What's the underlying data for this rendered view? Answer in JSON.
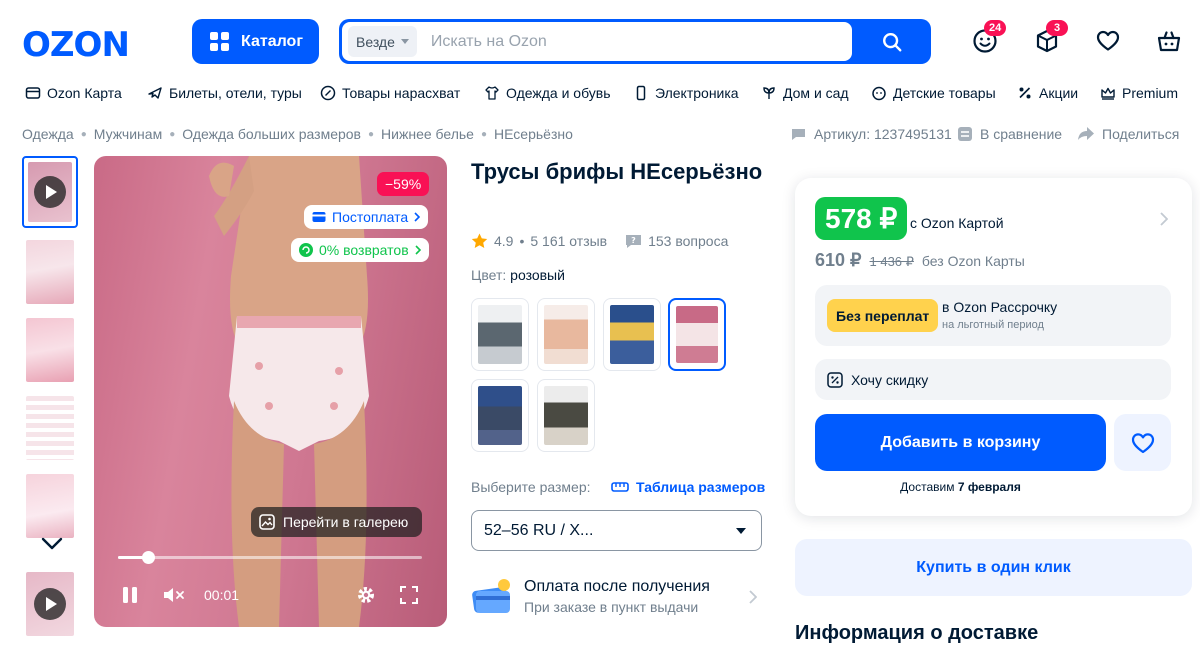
{
  "header": {
    "logo": "OZON",
    "catalog_label": "Каталог",
    "search_scope": "Везде",
    "search_placeholder": "Искать на Ozon",
    "badges": {
      "profile": "24",
      "orders": "3"
    }
  },
  "nav": [
    {
      "label": "Ozon Карта",
      "icon": "card-icon"
    },
    {
      "label": "Билеты, отели, туры",
      "icon": "plane-icon"
    },
    {
      "label": "Товары нарасхват",
      "icon": "percent-icon"
    },
    {
      "label": "Одежда и обувь",
      "icon": "clothes-icon"
    },
    {
      "label": "Электроника",
      "icon": "phone-icon"
    },
    {
      "label": "Дом и сад",
      "icon": "plant-icon"
    },
    {
      "label": "Детские товары",
      "icon": "baby-icon"
    },
    {
      "label": "Акции",
      "icon": "discount-icon"
    },
    {
      "label": "Premium",
      "icon": "crown-icon"
    }
  ],
  "breadcrumbs": [
    "Одежда",
    "Мужчинам",
    "Одежда больших размеров",
    "Нижнее белье",
    "НЕсерьёзно"
  ],
  "meta": {
    "article": "Артикул: 1237495131",
    "compare": "В сравнение",
    "share": "Поделиться"
  },
  "gallery": {
    "discount": "−59%",
    "chip_postpay": "Постоплата",
    "chip_returns": "0% возвратов",
    "gallery_button": "Перейти в галерею",
    "time": "00:01",
    "progress": 0.1
  },
  "product": {
    "title": "Трусы брифы НЕсерьёзно",
    "rating": "4.9",
    "reviews": "5 161 отзыв",
    "questions": "153 вопроса",
    "color_label": "Цвет:",
    "color_value": "розовый",
    "size_label": "Выберите размер:",
    "size_table": "Таблица размеров",
    "size_value": "52–56 RU / X...",
    "pay_title": "Оплата после получения",
    "pay_sub": "При заказе в пункт выдачи"
  },
  "buy": {
    "price_card": "578 ₽",
    "with_card": "с Ozon Картой",
    "price": "610 ₽",
    "old_price": "1 436 ₽",
    "without_card": "без Ozon Карты",
    "installment_tag": "Без переплат",
    "installment_title": "в Ozon Рассрочку",
    "installment_sub": "на льготный период",
    "want_discount": "Хочу скидку",
    "add_to_cart": "Добавить в корзину",
    "delivery_prefix": "Доставим",
    "delivery_date": "7 февраля",
    "one_click": "Купить в один клик",
    "delivery_info": "Информация о доставке"
  },
  "colors": {
    "brand": "#005bff",
    "sale": "#f91155",
    "green": "#10c44c",
    "yellow": "#ffd24d"
  }
}
